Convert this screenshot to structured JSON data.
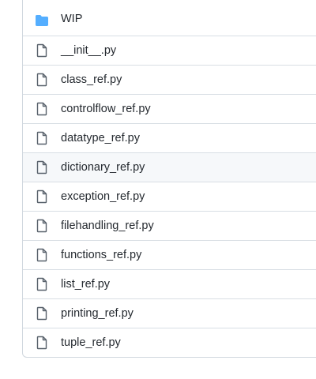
{
  "file_list": {
    "items": [
      {
        "name": "WIP",
        "type": "folder",
        "icon": "folder-icon",
        "highlighted": false
      },
      {
        "name": "__init__.py",
        "type": "file",
        "icon": "file-icon",
        "highlighted": false
      },
      {
        "name": "class_ref.py",
        "type": "file",
        "icon": "file-icon",
        "highlighted": false
      },
      {
        "name": "controlflow_ref.py",
        "type": "file",
        "icon": "file-icon",
        "highlighted": false
      },
      {
        "name": "datatype_ref.py",
        "type": "file",
        "icon": "file-icon",
        "highlighted": false
      },
      {
        "name": "dictionary_ref.py",
        "type": "file",
        "icon": "file-icon",
        "highlighted": true
      },
      {
        "name": "exception_ref.py",
        "type": "file",
        "icon": "file-icon",
        "highlighted": false
      },
      {
        "name": "filehandling_ref.py",
        "type": "file",
        "icon": "file-icon",
        "highlighted": false
      },
      {
        "name": "functions_ref.py",
        "type": "file",
        "icon": "file-icon",
        "highlighted": false
      },
      {
        "name": "list_ref.py",
        "type": "file",
        "icon": "file-icon",
        "highlighted": false
      },
      {
        "name": "printing_ref.py",
        "type": "file",
        "icon": "file-icon",
        "highlighted": false
      },
      {
        "name": "tuple_ref.py",
        "type": "file",
        "icon": "file-icon",
        "highlighted": false
      }
    ]
  },
  "colors": {
    "folder": "#54aeff",
    "file_icon": "#57606a",
    "text": "#24292f",
    "border": "#d0d7de",
    "highlight": "#f6f8fa"
  }
}
